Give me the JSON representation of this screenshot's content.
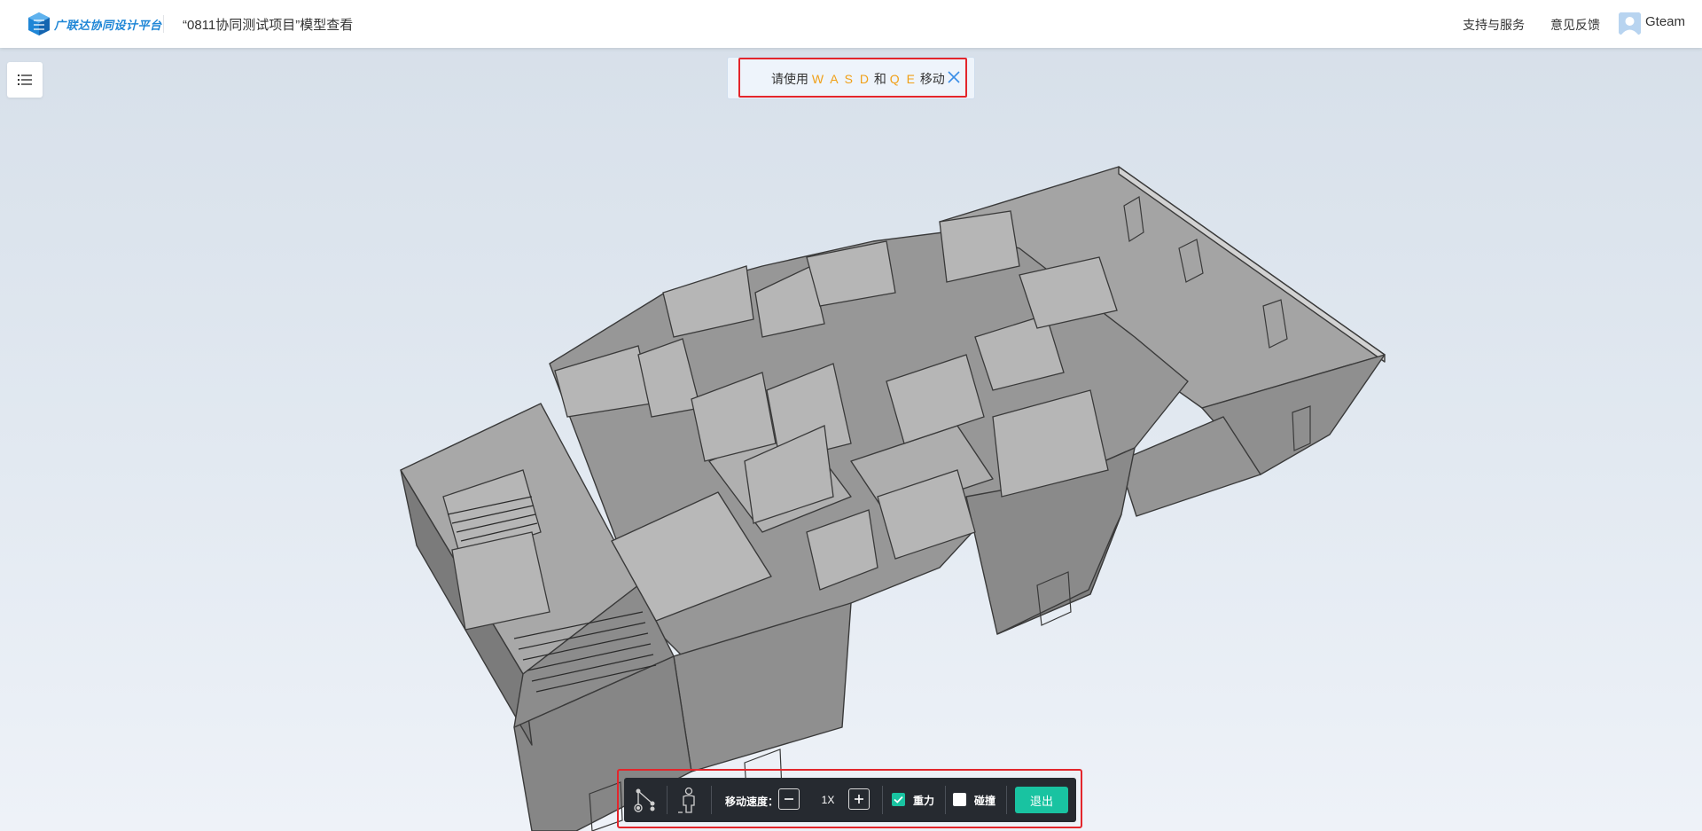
{
  "header": {
    "brand": "广联达协同设计平台",
    "project_title": "“0811协同测试项目”模型查看",
    "nav": {
      "support": "支持与服务",
      "feedback": "意见反馈"
    },
    "user": {
      "name": "Gteam"
    }
  },
  "sidebar": {
    "toggle_icon": "list-icon"
  },
  "notice": {
    "prefix": "请使用",
    "keys_move": "W A S D",
    "conj": "和",
    "keys_vertical": "Q E",
    "suffix": "移动",
    "close_icon": "close-icon"
  },
  "toolbar": {
    "speed_label": "移动速度：",
    "speed_value": "1X",
    "decrease_icon": "minus-icon",
    "increase_icon": "plus-icon",
    "gravity_label": "重力",
    "gravity_checked": true,
    "collision_label": "碰撞",
    "collision_checked": false,
    "exit_label": "退出"
  },
  "colors": {
    "accent": "#19c3a1",
    "highlight_key": "#f0a018",
    "annotation": "#e3262c",
    "brand": "#1f86d6"
  }
}
